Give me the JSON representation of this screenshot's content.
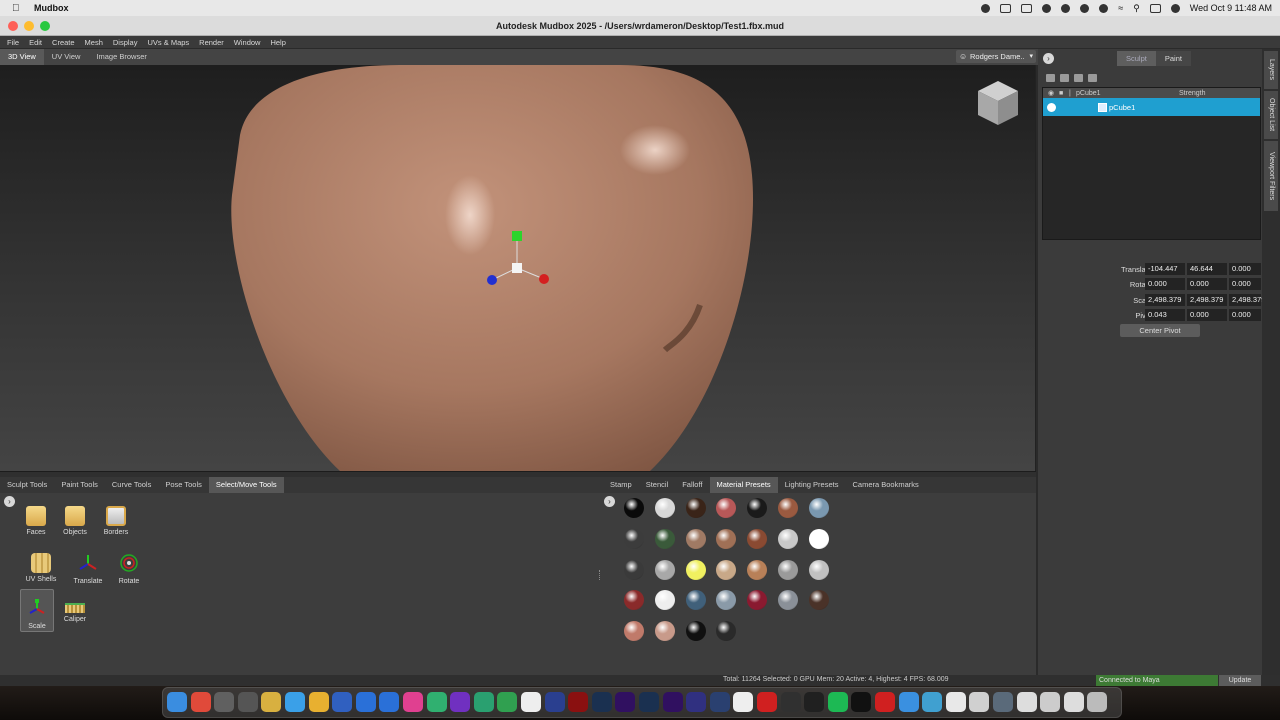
{
  "mac_menubar": {
    "app_name": "Mudbox",
    "clock": "Wed Oct 9  11:48 AM"
  },
  "window": {
    "title": "Autodesk Mudbox 2025 - /Users/wrdameron/Desktop/Test1.fbx.mud"
  },
  "menu": [
    "File",
    "Edit",
    "Create",
    "Mesh",
    "Display",
    "UVs & Maps",
    "Render",
    "Window",
    "Help"
  ],
  "viewport_tabs": [
    "3D View",
    "UV View",
    "Image Browser"
  ],
  "camera_select": "Rodgers Dame..",
  "right_panel": {
    "mode_tabs": [
      "Sculpt",
      "Paint"
    ],
    "side_tabs": [
      "Layers",
      "Object List",
      "Viewport Filters"
    ],
    "layers_header": {
      "col_layer": "pCube1",
      "col_strength": "Strength"
    },
    "layer_row": "pCube1",
    "transform": {
      "translate_label": "Translate",
      "translate": [
        "-104.447",
        "46.644",
        "0.000"
      ],
      "rotate_label": "Rotate",
      "rotate": [
        "0.000",
        "0.000",
        "0.000"
      ],
      "scale_label": "Scale",
      "scale": [
        "2,498.379",
        "2,498.379",
        "2,498.379"
      ],
      "pivot_label": "Pivot",
      "pivot": [
        "0.043",
        "0.000",
        "0.000"
      ],
      "center_pivot": "Center Pivot"
    }
  },
  "tool_tabs": [
    "Sculpt Tools",
    "Paint Tools",
    "Curve Tools",
    "Pose Tools",
    "Select/Move Tools"
  ],
  "tools": {
    "faces": "Faces",
    "objects": "Objects",
    "borders": "Borders",
    "uv_shells": "UV Shells",
    "translate": "Translate",
    "rotate": "Rotate",
    "scale": "Scale",
    "caliper": "Caliper"
  },
  "material_tabs": [
    "Stamp",
    "Stencil",
    "Falloff",
    "Material Presets",
    "Lighting Presets",
    "Camera Bookmarks"
  ],
  "material_spheres": [
    [
      "#0a0a0a",
      "#d8d8d8",
      "#3a2418",
      "#b85858",
      "#1a1a1a",
      "#9a5a40",
      "#7a98b0"
    ],
    [
      "#3c3c3c",
      "#3a5a3a",
      "#a07a64",
      "#a07056",
      "#8a4a32",
      "#c8c8c8",
      "#ffffff"
    ],
    [
      "#3a3a3a",
      "#a8a8a8",
      "#f0f060",
      "#c8a888",
      "#b88058",
      "#9a9a9a",
      "#c0c0c0"
    ],
    [
      "#8a2a2a",
      "#eeeeee",
      "#40607a",
      "#8a9aa8",
      "#8a1a30",
      "#8a9098",
      "#4a3228"
    ],
    [
      "#c07a6a",
      "#c89a8a",
      "#101010",
      "#2a2a2a"
    ]
  ],
  "status": {
    "stats": "Total: 11264  Selected: 0 GPU Mem: 20  Active: 4, Highest: 4  FPS: 68.009",
    "connected": "Connected to Maya",
    "update": "Update"
  }
}
